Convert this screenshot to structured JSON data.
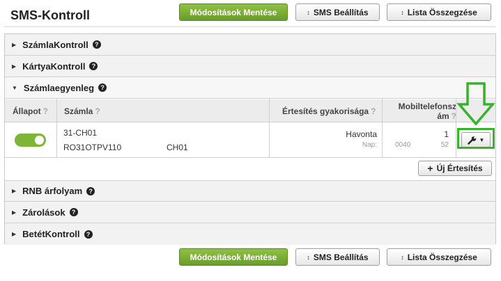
{
  "page": {
    "title": "SMS-Kontroll"
  },
  "toolbar": {
    "save_label": "Módosítások Mentése",
    "sms_settings_label": "SMS Beállítás",
    "list_summary_label": "Lista Összegzése",
    "sms_icon": "chevron-updown-icon",
    "list_icon": "chevron-updown-icon"
  },
  "sections": {
    "szamla_kontroll": "SzámlaKontroll",
    "kartya_kontroll": "KártyaKontroll",
    "szamlaegyenleg": "Számlaegyenleg",
    "rnb_arfolyam": "RNB árfolyam",
    "zarolasok": "Zárolások",
    "betet_kontroll": "BetétKontroll",
    "help_glyph": "?"
  },
  "table": {
    "columns": {
      "status": "Állapot",
      "account": "Számla",
      "frequency": "Értesítés gyakorisága",
      "phone_line1": "Mobiltelefonsz",
      "phone_line2": "ám",
      "help": "?"
    },
    "row": {
      "status_on": true,
      "account_name": "31-CH01",
      "account_iban": "RO31OTPV110",
      "account_currency": "CH01",
      "frequency": "Havonta",
      "day_label": "Nap:",
      "phone_count": "1",
      "phone_number_start": "0040",
      "phone_number_end": "52"
    }
  },
  "actions": {
    "new_notification_label": "Új Értesítés",
    "plus_glyph": "+"
  },
  "colors": {
    "accent_green": "#7cb537",
    "annotation_green": "#3ab12e"
  }
}
